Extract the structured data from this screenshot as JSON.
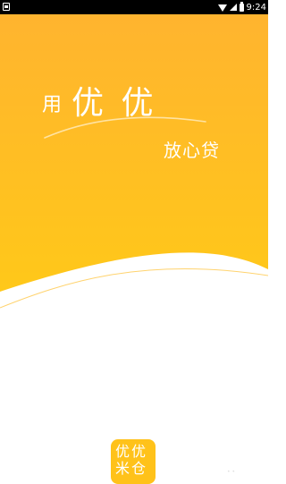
{
  "status_bar": {
    "time": "9:24",
    "icons": [
      "notification-icon",
      "wifi-icon",
      "signal-icon",
      "battery-icon"
    ]
  },
  "splash": {
    "prefix": "用",
    "brand": "优 优",
    "tagline": "放心贷"
  },
  "logo": {
    "line1": "优优",
    "line2": "米仓"
  },
  "colors": {
    "gradient_top": "#ffb82e",
    "gradient_bottom": "#ffc21a",
    "text": "#ffffff",
    "background": "#ffffff"
  }
}
